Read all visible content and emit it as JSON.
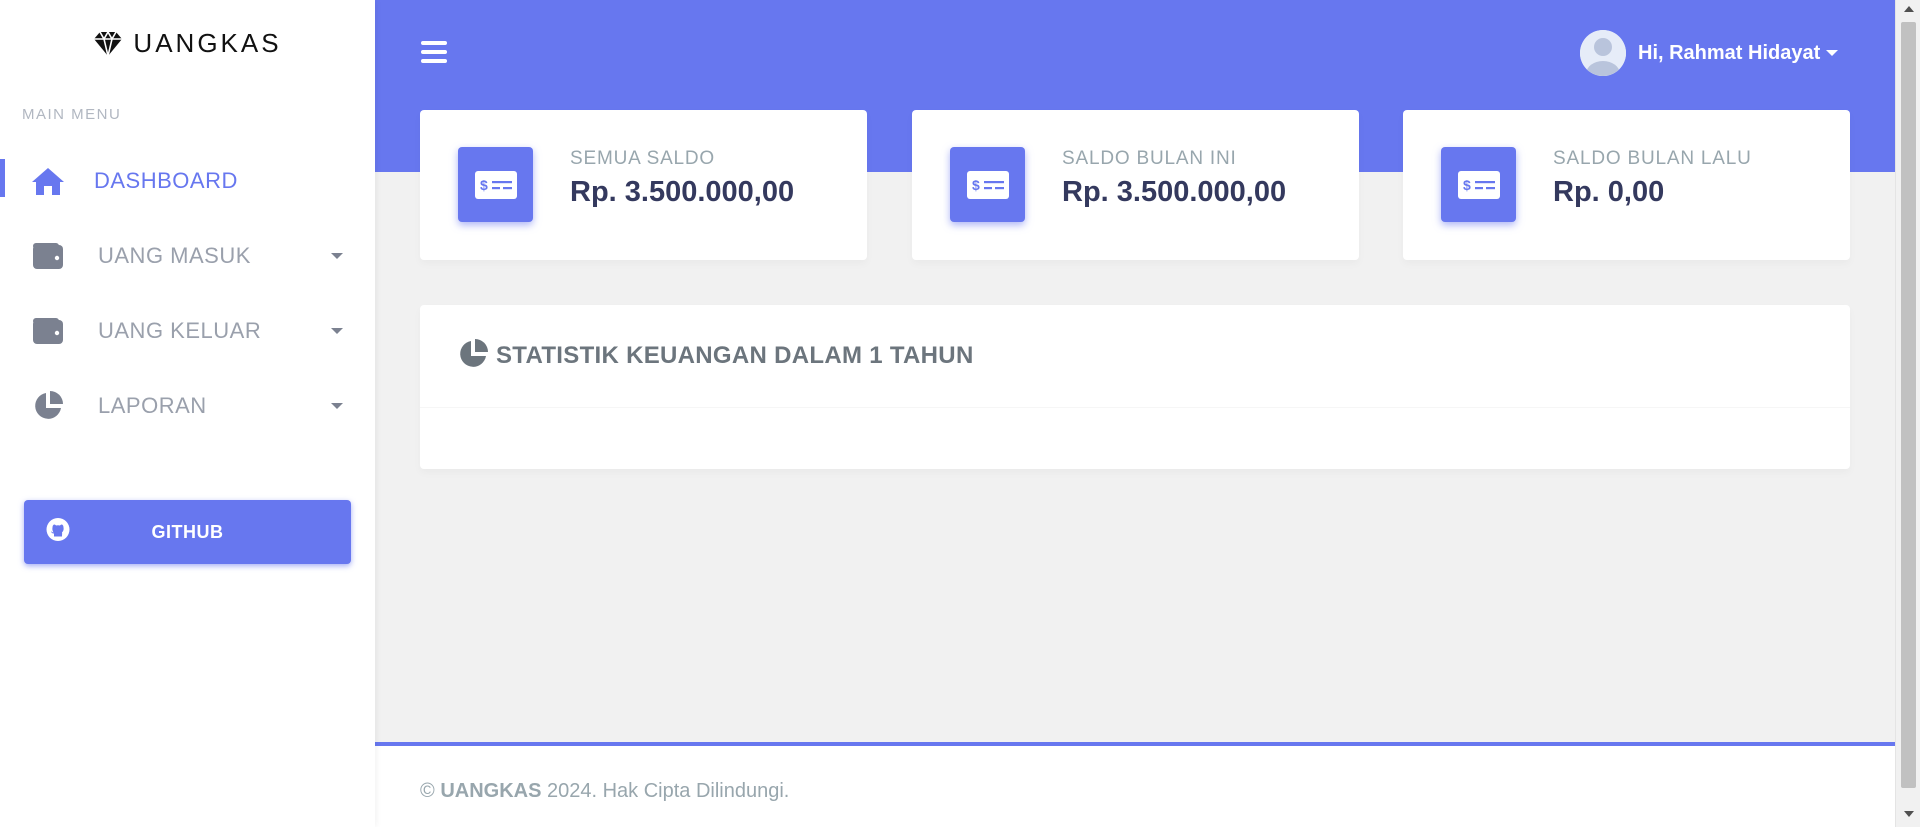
{
  "brand": {
    "name": "UANGKAS",
    "icon": "diamond-icon"
  },
  "sidebar": {
    "heading": "MAIN MENU",
    "items": [
      {
        "label": "DASHBOARD",
        "icon": "home-icon",
        "active": true,
        "has_caret": false
      },
      {
        "label": "UANG MASUK",
        "icon": "wallet-icon",
        "active": false,
        "has_caret": true
      },
      {
        "label": "UANG KELUAR",
        "icon": "wallet-icon",
        "active": false,
        "has_caret": true
      },
      {
        "label": "LAPORAN",
        "icon": "pie-chart-icon",
        "active": false,
        "has_caret": true
      }
    ],
    "github_label": "GITHUB"
  },
  "header": {
    "menu_icon": "hamburger-icon",
    "user_greeting": "Hi, Rahmat Hidayat"
  },
  "cards": [
    {
      "title": "SEMUA SALDO",
      "value": "Rp. 3.500.000,00",
      "icon": "money-check-icon"
    },
    {
      "title": "SALDO BULAN INI",
      "value": "Rp. 3.500.000,00",
      "icon": "money-check-icon"
    },
    {
      "title": "SALDO BULAN LALU",
      "value": "Rp. 0,00",
      "icon": "money-check-icon"
    }
  ],
  "statistic": {
    "title": "STATISTIK KEUANGAN DALAM 1 TAHUN",
    "icon": "pie-chart-icon"
  },
  "footer": {
    "copyright_symbol": "©",
    "brand": "UANGKAS",
    "text": "2024. Hak Cipta Dilindungi."
  },
  "colors": {
    "primary": "#6777ef",
    "sidebar_text": "#9aa0ac",
    "card_value": "#34395e",
    "muted": "#98a6ad",
    "background": "#f1f1f1"
  }
}
